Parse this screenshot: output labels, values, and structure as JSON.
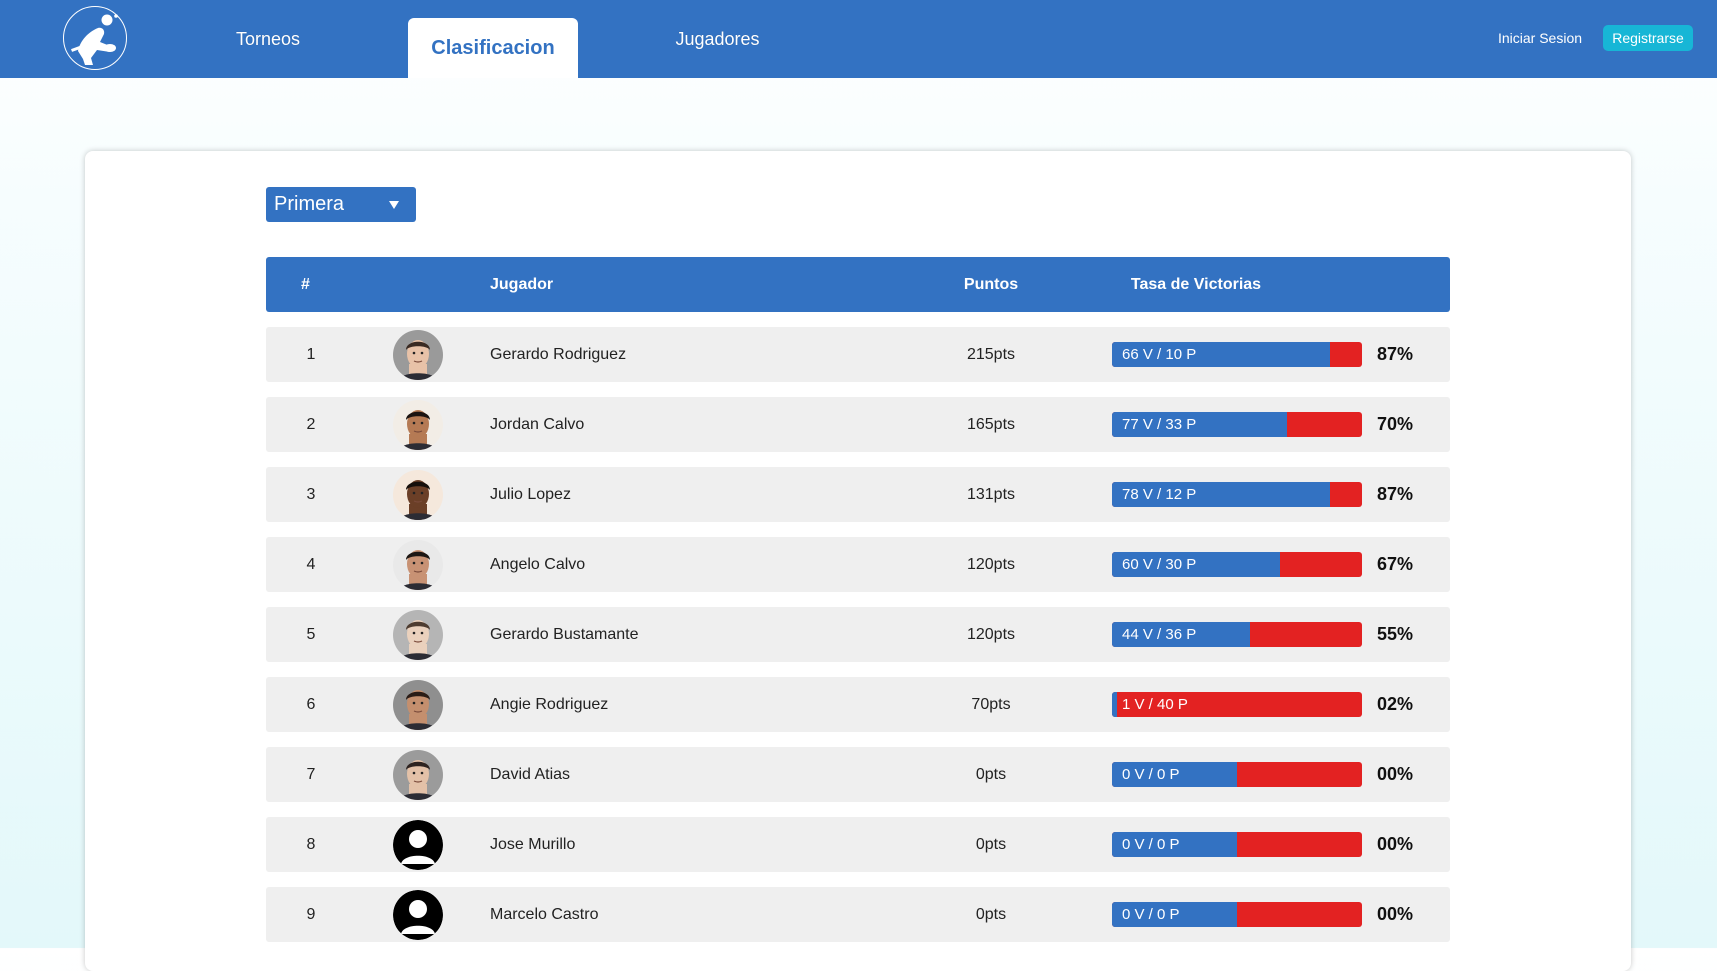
{
  "nav": {
    "tabs": [
      {
        "label": "Torneos"
      },
      {
        "label": "Clasificacion",
        "active": true
      },
      {
        "label": "Jugadores"
      }
    ],
    "login_label": "Iniciar Sesion",
    "register_label": "Registrarse"
  },
  "filter": {
    "division": "Primera"
  },
  "table": {
    "headers": {
      "rank": "#",
      "player": "Jugador",
      "points": "Puntos",
      "rate": "Tasa de Victorias"
    },
    "rows": [
      {
        "rank": "1",
        "name": "Gerardo Rodriguez",
        "points": "215pts",
        "record": "66 V / 10 P",
        "win_fraction": 0.87,
        "percent": "87%",
        "avatar": "photo",
        "skin": "#e8c2a8",
        "hair": "#3a2a22",
        "bg": "#9a9a9a"
      },
      {
        "rank": "2",
        "name": "Jordan Calvo",
        "points": "165pts",
        "record": "77 V / 33 P",
        "win_fraction": 0.7,
        "percent": "70%",
        "avatar": "photo",
        "skin": "#b57a54",
        "hair": "#1a1311",
        "bg": "#f2ede6"
      },
      {
        "rank": "3",
        "name": "Julio Lopez",
        "points": "131pts",
        "record": "78 V / 12 P",
        "win_fraction": 0.87,
        "percent": "87%",
        "avatar": "photo",
        "skin": "#6b3f27",
        "hair": "#160f0b",
        "bg": "#f5e8dc"
      },
      {
        "rank": "4",
        "name": "Angelo Calvo",
        "points": "120pts",
        "record": "60 V / 30 P",
        "win_fraction": 0.67,
        "percent": "67%",
        "avatar": "photo",
        "skin": "#c89274",
        "hair": "#1c1613",
        "bg": "#e9e9e9"
      },
      {
        "rank": "5",
        "name": "Gerardo Bustamante",
        "points": "120pts",
        "record": "44 V / 36 P",
        "win_fraction": 0.55,
        "percent": "55%",
        "avatar": "photo",
        "skin": "#ead1bd",
        "hair": "#4e3c30",
        "bg": "#b5b5b5"
      },
      {
        "rank": "6",
        "name": "Angie Rodriguez",
        "points": "70pts",
        "record": "1 V / 40 P",
        "win_fraction": 0.02,
        "percent": "02%",
        "avatar": "photo",
        "skin": "#c48f6e",
        "hair": "#2a1c16",
        "bg": "#8f8f8f"
      },
      {
        "rank": "7",
        "name": "David Atias",
        "points": "0pts",
        "record": "0 V / 0 P",
        "win_fraction": 0.5,
        "percent": "00%",
        "avatar": "photo",
        "skin": "#e3c1a8",
        "hair": "#2e2320",
        "bg": "#9b9b9b"
      },
      {
        "rank": "8",
        "name": "Jose Murillo",
        "points": "0pts",
        "record": "0 V / 0 P",
        "win_fraction": 0.5,
        "percent": "00%",
        "avatar": "default"
      },
      {
        "rank": "9",
        "name": "Marcelo Castro",
        "points": "0pts",
        "record": "0 V / 0 P",
        "win_fraction": 0.5,
        "percent": "00%",
        "avatar": "default"
      }
    ]
  },
  "colors": {
    "primary": "#3372c2",
    "loss": "#e32222",
    "register": "#17b6d6"
  },
  "icons": {
    "logo": "table-tennis-player-icon",
    "caret": "caret-down-icon",
    "default_avatar": "user-silhouette-icon"
  }
}
